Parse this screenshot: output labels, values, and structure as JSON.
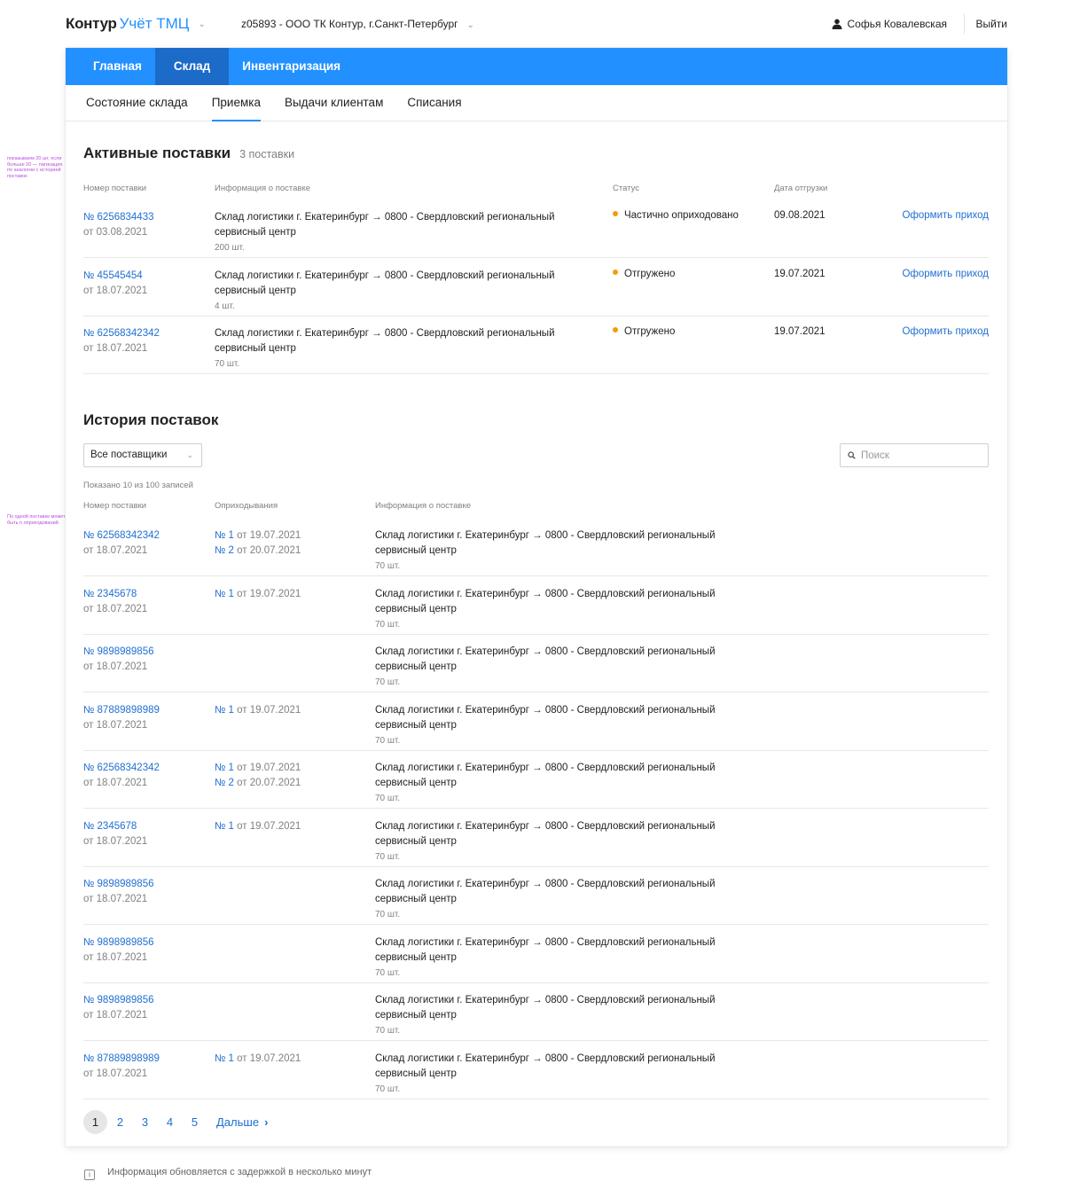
{
  "notes": {
    "active": "показываем 20 шт, если больше 20 — пагинация по аналогии с историей поставок",
    "history": "По одной поставке может быть n оприходований"
  },
  "header": {
    "brand": "Контур",
    "product": "Учёт ТМЦ",
    "org": "z05893 - ООО ТК Контур, г.Санкт-Петербург",
    "user": "Софья Ковалевская",
    "logout": "Выйти"
  },
  "nav": [
    "Главная",
    "Склад",
    "Инвентаризация"
  ],
  "subnav": [
    "Состояние склада",
    "Приемка",
    "Выдачи клиентам",
    "Списания"
  ],
  "active": {
    "title": "Активные поставки",
    "count": "3 поставки",
    "columns": [
      "Номер поставки",
      "Информация о поставке",
      "Статус",
      "Дата отгрузки"
    ],
    "rows": [
      {
        "num": "№ 6256834433",
        "date": "от 03.08.2021",
        "info1": "Склад логистики г. Екатеринбург → 0800 - Свердловский региональный",
        "info2": "сервисный центр",
        "qty": "200 шт.",
        "status": "Частично оприходовано",
        "ship": "09.08.2021",
        "action": "Оформить приход"
      },
      {
        "num": "№ 45545454",
        "date": "от 18.07.2021",
        "info1": "Склад логистики г. Екатеринбург → 0800 - Свердловский региональный",
        "info2": "сервисный центр",
        "qty": "4 шт.",
        "status": "Отгружено",
        "ship": "19.07.2021",
        "action": "Оформить приход"
      },
      {
        "num": "№ 62568342342",
        "date": "от 18.07.2021",
        "info1": "Склад логистики г. Екатеринбург → 0800 - Свердловский региональный",
        "info2": "сервисный центр",
        "qty": "70 шт.",
        "status": "Отгружено",
        "ship": "19.07.2021",
        "action": "Оформить приход"
      }
    ],
    "status_color": "#f69c00"
  },
  "history": {
    "title": "История поставок",
    "filter": "Все поставщики",
    "search_placeholder": "Поиск",
    "shown": "Показано 10 из 100 записей",
    "columns": [
      "Номер поставки",
      "Оприходывания",
      "Информация о поставке"
    ],
    "rows": [
      {
        "num": "№ 62568342342",
        "date": "от 18.07.2021",
        "rec": [
          {
            "n": "№ 1",
            "d": "от 19.07.2021"
          },
          {
            "n": "№ 2",
            "d": "от 20.07.2021"
          }
        ],
        "info1": "Склад логистики г. Екатеринбург → 0800 - Свердловский региональный",
        "info2": "сервисный центр",
        "qty": "70 шт."
      },
      {
        "num": "№ 2345678",
        "date": "от 18.07.2021",
        "rec": [
          {
            "n": "№ 1",
            "d": "от 19.07.2021"
          }
        ],
        "info1": "Склад логистики г. Екатеринбург → 0800 - Свердловский региональный",
        "info2": "сервисный центр",
        "qty": "70 шт."
      },
      {
        "num": "№ 9898989856",
        "date": "от 18.07.2021",
        "rec": [],
        "info1": "Склад логистики г. Екатеринбург → 0800 - Свердловский региональный",
        "info2": "сервисный центр",
        "qty": "70 шт."
      },
      {
        "num": "№ 87889898989",
        "date": "от 18.07.2021",
        "rec": [
          {
            "n": "№ 1",
            "d": "от 19.07.2021"
          }
        ],
        "info1": "Склад логистики г. Екатеринбург → 0800 - Свердловский региональный",
        "info2": "сервисный центр",
        "qty": "70 шт."
      },
      {
        "num": "№ 62568342342",
        "date": "от 18.07.2021",
        "rec": [
          {
            "n": "№ 1",
            "d": "от 19.07.2021"
          },
          {
            "n": "№ 2",
            "d": "от 20.07.2021"
          }
        ],
        "info1": "Склад логистики г. Екатеринбург → 0800 - Свердловский региональный",
        "info2": "сервисный центр",
        "qty": "70 шт."
      },
      {
        "num": "№ 2345678",
        "date": "от 18.07.2021",
        "rec": [
          {
            "n": "№ 1",
            "d": "от 19.07.2021"
          }
        ],
        "info1": "Склад логистики г. Екатеринбург → 0800 - Свердловский региональный",
        "info2": "сервисный центр",
        "qty": "70 шт."
      },
      {
        "num": "№ 9898989856",
        "date": "от 18.07.2021",
        "rec": [],
        "info1": "Склад логистики г. Екатеринбург → 0800 - Свердловский региональный",
        "info2": "сервисный центр",
        "qty": "70 шт."
      },
      {
        "num": "№ 9898989856",
        "date": "от 18.07.2021",
        "rec": [],
        "info1": "Склад логистики г. Екатеринбург → 0800 - Свердловский региональный",
        "info2": "сервисный центр",
        "qty": "70 шт."
      },
      {
        "num": "№ 9898989856",
        "date": "от 18.07.2021",
        "rec": [],
        "info1": "Склад логистики г. Екатеринбург → 0800 - Свердловский региональный",
        "info2": "сервисный центр",
        "qty": "70 шт."
      },
      {
        "num": "№ 87889898989",
        "date": "от 18.07.2021",
        "rec": [
          {
            "n": "№ 1",
            "d": "от 19.07.2021"
          }
        ],
        "info1": "Склад логистики г. Екатеринбург → 0800 - Свердловский региональный",
        "info2": "сервисный центр",
        "qty": "70 шт."
      }
    ]
  },
  "pagination": {
    "pages": [
      "1",
      "2",
      "3",
      "4",
      "5"
    ],
    "current": "1",
    "next": "Дальше"
  },
  "footer": "Информация обновляется с задержкой в несколько минут",
  "colors": {
    "accent": "#2291ff",
    "nav_active": "#1c6bc9",
    "link": "#1f6fd1"
  }
}
